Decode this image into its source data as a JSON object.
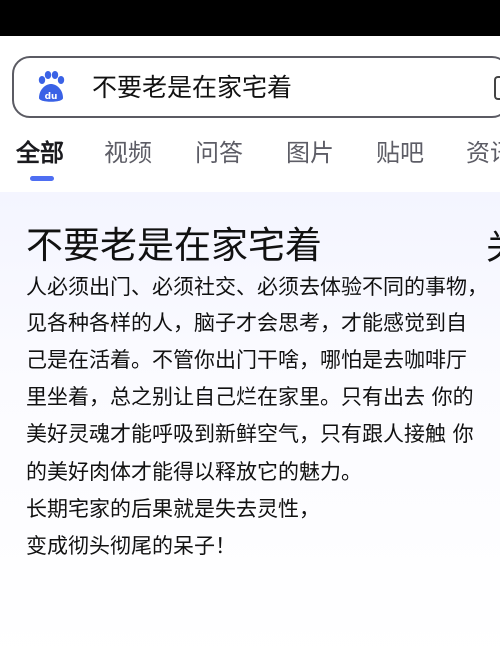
{
  "search": {
    "query": "不要老是在家宅着",
    "icon": "baidu-paw-icon",
    "accent": "#4e6ef2"
  },
  "tabs": [
    {
      "label": "全部",
      "active": true
    },
    {
      "label": "视频"
    },
    {
      "label": "问答"
    },
    {
      "label": "图片"
    },
    {
      "label": "贴吧"
    },
    {
      "label": "资讯"
    }
  ],
  "article": {
    "title": "不要老是在家宅着",
    "cut_glyph": "关",
    "lines": [
      "人必须出门、必须社交、必须去体验不同的事物，",
      "见各种各样的人，脑子才会思考，才能感觉到自",
      "己是在活着。不管你出门干啥，哪怕是去咖啡厅",
      "里坐着，总之别让自己烂在家里。只有出去 你的",
      "美好灵魂才能呼吸到新鲜空气，只有跟人接触 你",
      "的美好肉体才能得以释放它的魅力。",
      "长期宅家的后果就是失去灵性，",
      "变成彻头彻尾的呆子！"
    ]
  }
}
